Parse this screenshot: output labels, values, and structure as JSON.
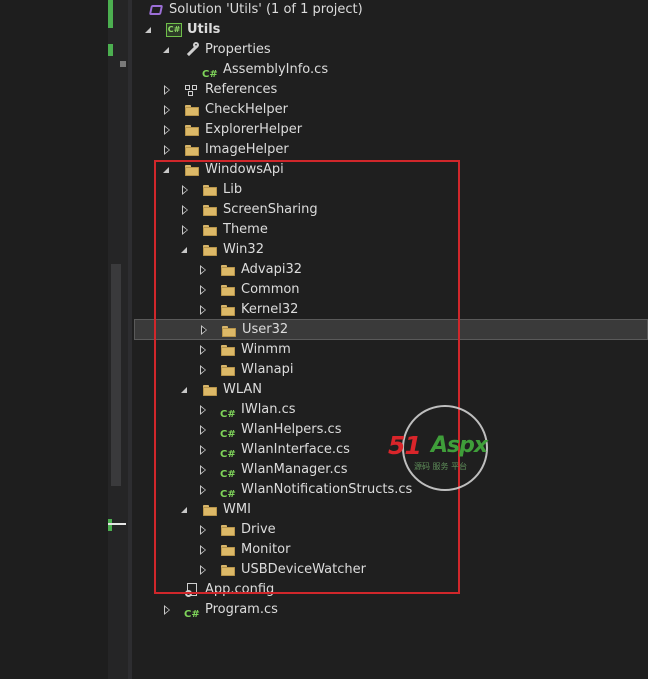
{
  "solution": {
    "label": "Solution 'Utils' (1 of 1 project)",
    "icon": "visual-studio-solution-icon"
  },
  "project": {
    "label": "Utils",
    "icon_text": "C#"
  },
  "properties": {
    "label": "Properties"
  },
  "assembly_info": {
    "label": "AssemblyInfo.cs"
  },
  "references": {
    "label": "References"
  },
  "folders": {
    "check_helper": "CheckHelper",
    "explorer_helper": "ExplorerHelper",
    "image_helper": "ImageHelper",
    "windows_api": "WindowsApi",
    "lib": "Lib",
    "screen_sharing": "ScreenSharing",
    "theme": "Theme",
    "win32": "Win32",
    "advapi32": "Advapi32",
    "common": "Common",
    "kernel32": "Kernel32",
    "user32": "User32",
    "winmm": "Winmm",
    "wlanapi": "Wlanapi",
    "wlan": "WLAN",
    "wmi": "WMI",
    "drive": "Drive",
    "monitor": "Monitor",
    "usb_device_watcher": "USBDeviceWatcher"
  },
  "files": {
    "iwlan": "IWlan.cs",
    "wlan_helpers": "WlanHelpers.cs",
    "wlan_interface": "WlanInterface.cs",
    "wlan_manager": "WlanManager.cs",
    "wlan_notification_structs": "WlanNotificationStructs.cs",
    "app_config": "App.config",
    "program": "Program.cs"
  },
  "cs_badge": "C#",
  "selected_item": "User32",
  "colors": {
    "highlight_box": "#d0272b",
    "folder": "#dcb867",
    "cs_icon": "#7fd45a"
  },
  "watermark": {
    "num": "51",
    "brand": "Aspx",
    "sub": "源码 服务 平台"
  }
}
